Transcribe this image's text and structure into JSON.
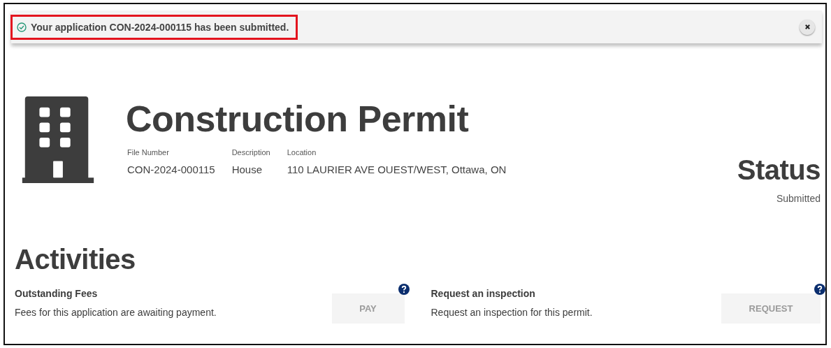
{
  "notification": {
    "message": "Your application CON-2024-000115 has been submitted.",
    "highlighted": true
  },
  "permit": {
    "title": "Construction Permit",
    "fields": [
      {
        "label": "File Number",
        "value": "CON-2024-000115"
      },
      {
        "label": "Description",
        "value": "House"
      },
      {
        "label": "Location",
        "value": "110 LAURIER AVE OUEST/WEST, Ottawa, ON"
      }
    ],
    "status": {
      "heading": "Status",
      "value": "Submitted"
    }
  },
  "activities": {
    "heading": "Activities",
    "items": [
      {
        "title": "Outstanding Fees",
        "description": "Fees for this application are awaiting payment.",
        "button": {
          "label": "PAY",
          "disabled": true
        }
      },
      {
        "title": "Request an inspection",
        "description": "Request an inspection for this permit.",
        "button": {
          "label": "REQUEST",
          "disabled": true
        }
      }
    ]
  }
}
